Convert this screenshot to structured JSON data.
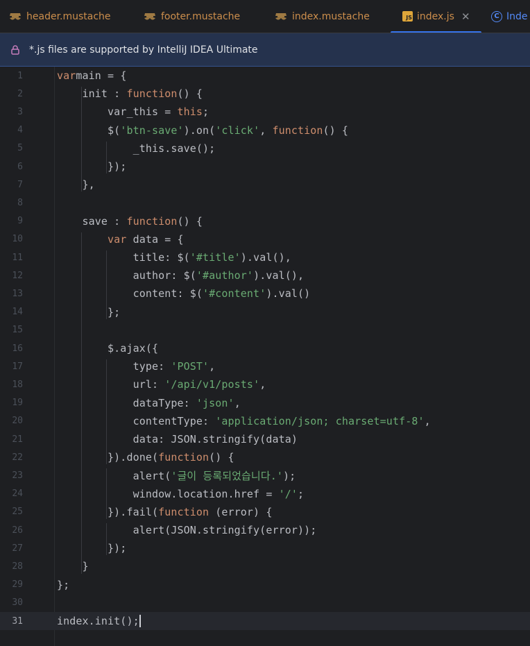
{
  "tabs": [
    {
      "label": "header.mustache",
      "icon": "mustache-icon"
    },
    {
      "label": "footer.mustache",
      "icon": "mustache-icon"
    },
    {
      "label": "index.mustache",
      "icon": "mustache-icon"
    },
    {
      "label": "index.js",
      "icon": "js-icon",
      "active": true,
      "icon_text": "JS"
    },
    {
      "label": "Inde",
      "icon": "class-icon",
      "icon_text": "C"
    }
  ],
  "banner": {
    "text": "*.js files are supported by IntelliJ IDEA Ultimate",
    "icon": "lock-icon"
  },
  "editor": {
    "current_line": 31,
    "lines": [
      {
        "n": "1",
        "tokens": [
          [
            "kw",
            "var"
          ],
          [
            "",
            "main = {"
          ]
        ]
      },
      {
        "n": "2",
        "tokens": [
          [
            "",
            "    init : "
          ],
          [
            "kw",
            "function"
          ],
          [
            "",
            "() {"
          ]
        ]
      },
      {
        "n": "3",
        "tokens": [
          [
            "",
            "        var_this = "
          ],
          [
            "kw",
            "this"
          ],
          [
            "",
            ";"
          ]
        ]
      },
      {
        "n": "4",
        "tokens": [
          [
            "",
            "        $("
          ],
          [
            "str",
            "'btn-save'"
          ],
          [
            "",
            ").on("
          ],
          [
            "str",
            "'click'"
          ],
          [
            "",
            ", "
          ],
          [
            "kw",
            "function"
          ],
          [
            "",
            "() {"
          ]
        ]
      },
      {
        "n": "5",
        "tokens": [
          [
            "",
            "            _this.save();"
          ]
        ]
      },
      {
        "n": "6",
        "tokens": [
          [
            "",
            "        });"
          ]
        ]
      },
      {
        "n": "7",
        "tokens": [
          [
            "",
            "    },"
          ]
        ]
      },
      {
        "n": "8",
        "tokens": []
      },
      {
        "n": "9",
        "tokens": [
          [
            "",
            "    save : "
          ],
          [
            "kw",
            "function"
          ],
          [
            "",
            "() {"
          ]
        ]
      },
      {
        "n": "10",
        "tokens": [
          [
            "",
            "        "
          ],
          [
            "kw",
            "var"
          ],
          [
            "",
            " data = {"
          ]
        ]
      },
      {
        "n": "11",
        "tokens": [
          [
            "",
            "            title: $("
          ],
          [
            "str",
            "'#title'"
          ],
          [
            "",
            ").val(),"
          ]
        ]
      },
      {
        "n": "12",
        "tokens": [
          [
            "",
            "            author: $("
          ],
          [
            "str",
            "'#author'"
          ],
          [
            "",
            ").val(),"
          ]
        ]
      },
      {
        "n": "13",
        "tokens": [
          [
            "",
            "            content: $("
          ],
          [
            "str",
            "'#content'"
          ],
          [
            "",
            ").val()"
          ]
        ]
      },
      {
        "n": "14",
        "tokens": [
          [
            "",
            "        };"
          ]
        ]
      },
      {
        "n": "15",
        "tokens": []
      },
      {
        "n": "16",
        "tokens": [
          [
            "",
            "        $.ajax({"
          ]
        ]
      },
      {
        "n": "17",
        "tokens": [
          [
            "",
            "            type: "
          ],
          [
            "str",
            "'POST'"
          ],
          [
            "",
            ","
          ]
        ]
      },
      {
        "n": "18",
        "tokens": [
          [
            "",
            "            url: "
          ],
          [
            "str",
            "'/api/v1/posts'"
          ],
          [
            "",
            ","
          ]
        ]
      },
      {
        "n": "19",
        "tokens": [
          [
            "",
            "            dataType: "
          ],
          [
            "str",
            "'json'"
          ],
          [
            "",
            ","
          ]
        ]
      },
      {
        "n": "20",
        "tokens": [
          [
            "",
            "            contentType: "
          ],
          [
            "str",
            "'application/json; charset=utf-8'"
          ],
          [
            "",
            ","
          ]
        ]
      },
      {
        "n": "21",
        "tokens": [
          [
            "",
            "            data: JSON.stringify(data)"
          ]
        ]
      },
      {
        "n": "22",
        "tokens": [
          [
            "",
            "        }).done("
          ],
          [
            "kw",
            "function"
          ],
          [
            "",
            "() {"
          ]
        ]
      },
      {
        "n": "23",
        "tokens": [
          [
            "",
            "            alert("
          ],
          [
            "str",
            "'글이 등록되었습니다.'"
          ],
          [
            "",
            ");"
          ]
        ]
      },
      {
        "n": "24",
        "tokens": [
          [
            "",
            "            window.location.href = "
          ],
          [
            "str",
            "'/'"
          ],
          [
            "",
            ";"
          ]
        ]
      },
      {
        "n": "25",
        "tokens": [
          [
            "",
            "        }).fail("
          ],
          [
            "kw",
            "function"
          ],
          [
            "",
            " (error) {"
          ]
        ]
      },
      {
        "n": "26",
        "tokens": [
          [
            "",
            "            alert(JSON.stringify(error));"
          ]
        ]
      },
      {
        "n": "27",
        "tokens": [
          [
            "",
            "        });"
          ]
        ]
      },
      {
        "n": "28",
        "tokens": [
          [
            "",
            "    }"
          ]
        ]
      },
      {
        "n": "29",
        "tokens": [
          [
            "",
            "};"
          ]
        ]
      },
      {
        "n": "30",
        "tokens": []
      },
      {
        "n": "31",
        "tokens": [
          [
            "",
            "index.init();"
          ]
        ]
      }
    ]
  },
  "colors": {
    "keyword": "#cf8e6d",
    "string": "#6aab73",
    "text": "#bcbec4",
    "accent": "#3574f0"
  }
}
